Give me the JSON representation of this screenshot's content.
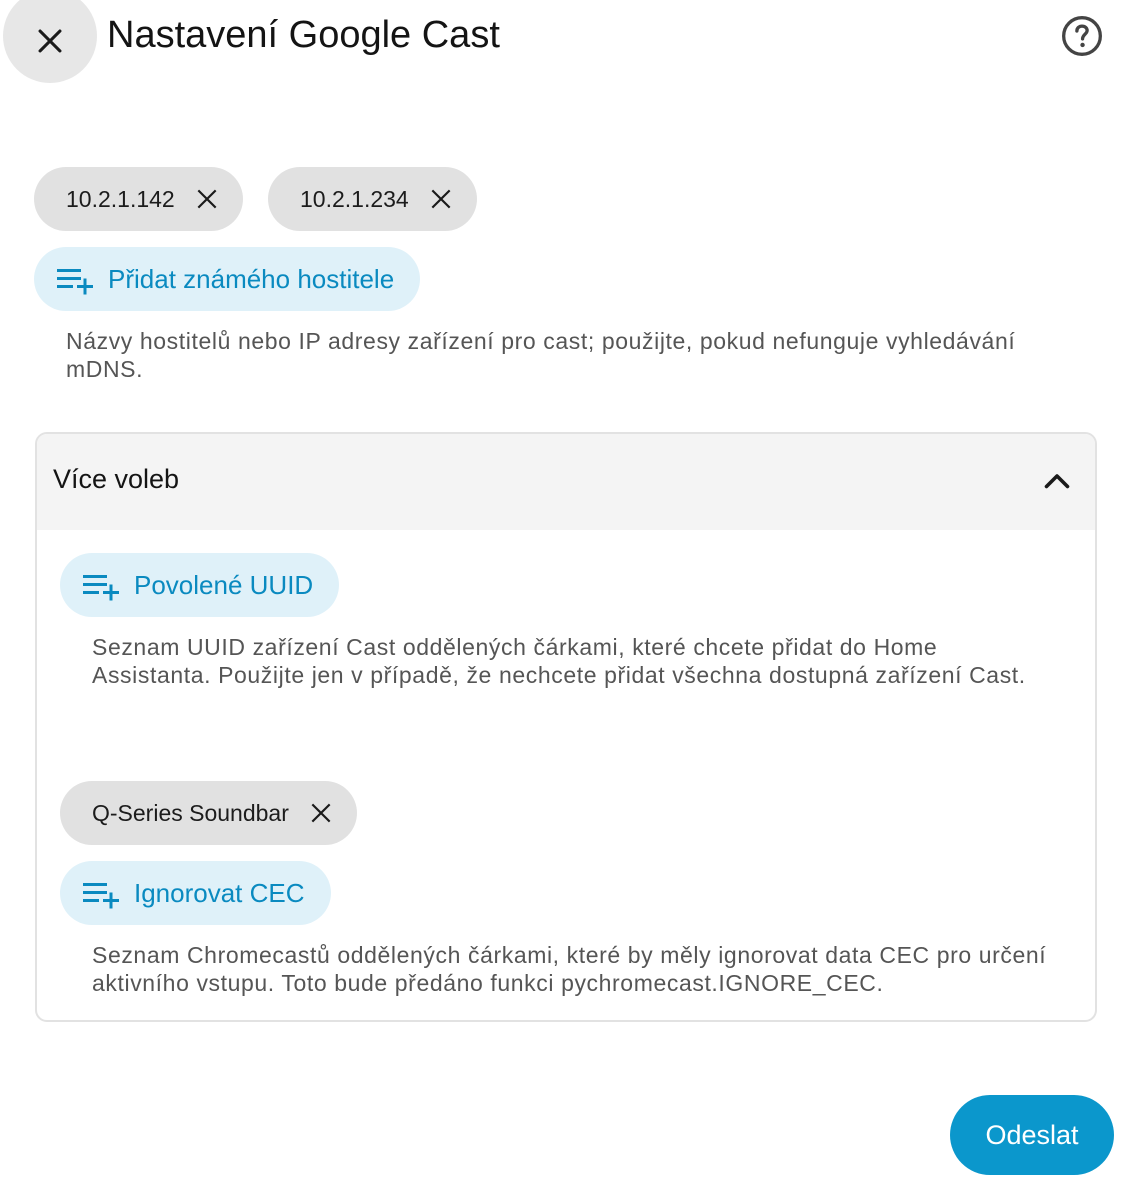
{
  "dialog": {
    "title": "Nastavení Google Cast",
    "close_icon": "close-icon",
    "help_icon": "help-circle-icon"
  },
  "known_hosts": {
    "chips": [
      {
        "label": "10.2.1.142"
      },
      {
        "label": "10.2.1.234"
      }
    ],
    "add_label": "Přidat známého hostitele",
    "add_icon": "playlist-add-icon",
    "helper": "Názvy hostitelů nebo IP adresy zařízení pro cast; použijte, pokud nefunguje vyhledávání mDNS."
  },
  "more_options": {
    "title": "Více voleb",
    "chevron_icon": "chevron-up-icon",
    "expanded": true,
    "allowed_uuids": {
      "add_label": "Povolené UUID",
      "helper": "Seznam UUID zařízení Cast oddělených čárkami, které chcete přidat do Home Assistanta. Použijte jen v případě, že nechcete přidat všechna dostupná zařízení Cast."
    },
    "ignore_cec": {
      "chips": [
        {
          "label": "Q-Series Soundbar"
        }
      ],
      "add_label": "Ignorovat CEC",
      "helper": "Seznam Chromecastů oddělených čárkami, které by měly ignorovat data CEC pro určení aktivního vstupu. Toto bude předáno funkci pychromecast.IGNORE_CEC."
    }
  },
  "submit": {
    "label": "Odeslat"
  },
  "colors": {
    "accent": "#0b97cc",
    "accent_text": "#0a8ac0",
    "accent_bg": "#dff1f9",
    "chip_bg": "#e1e1e1"
  }
}
